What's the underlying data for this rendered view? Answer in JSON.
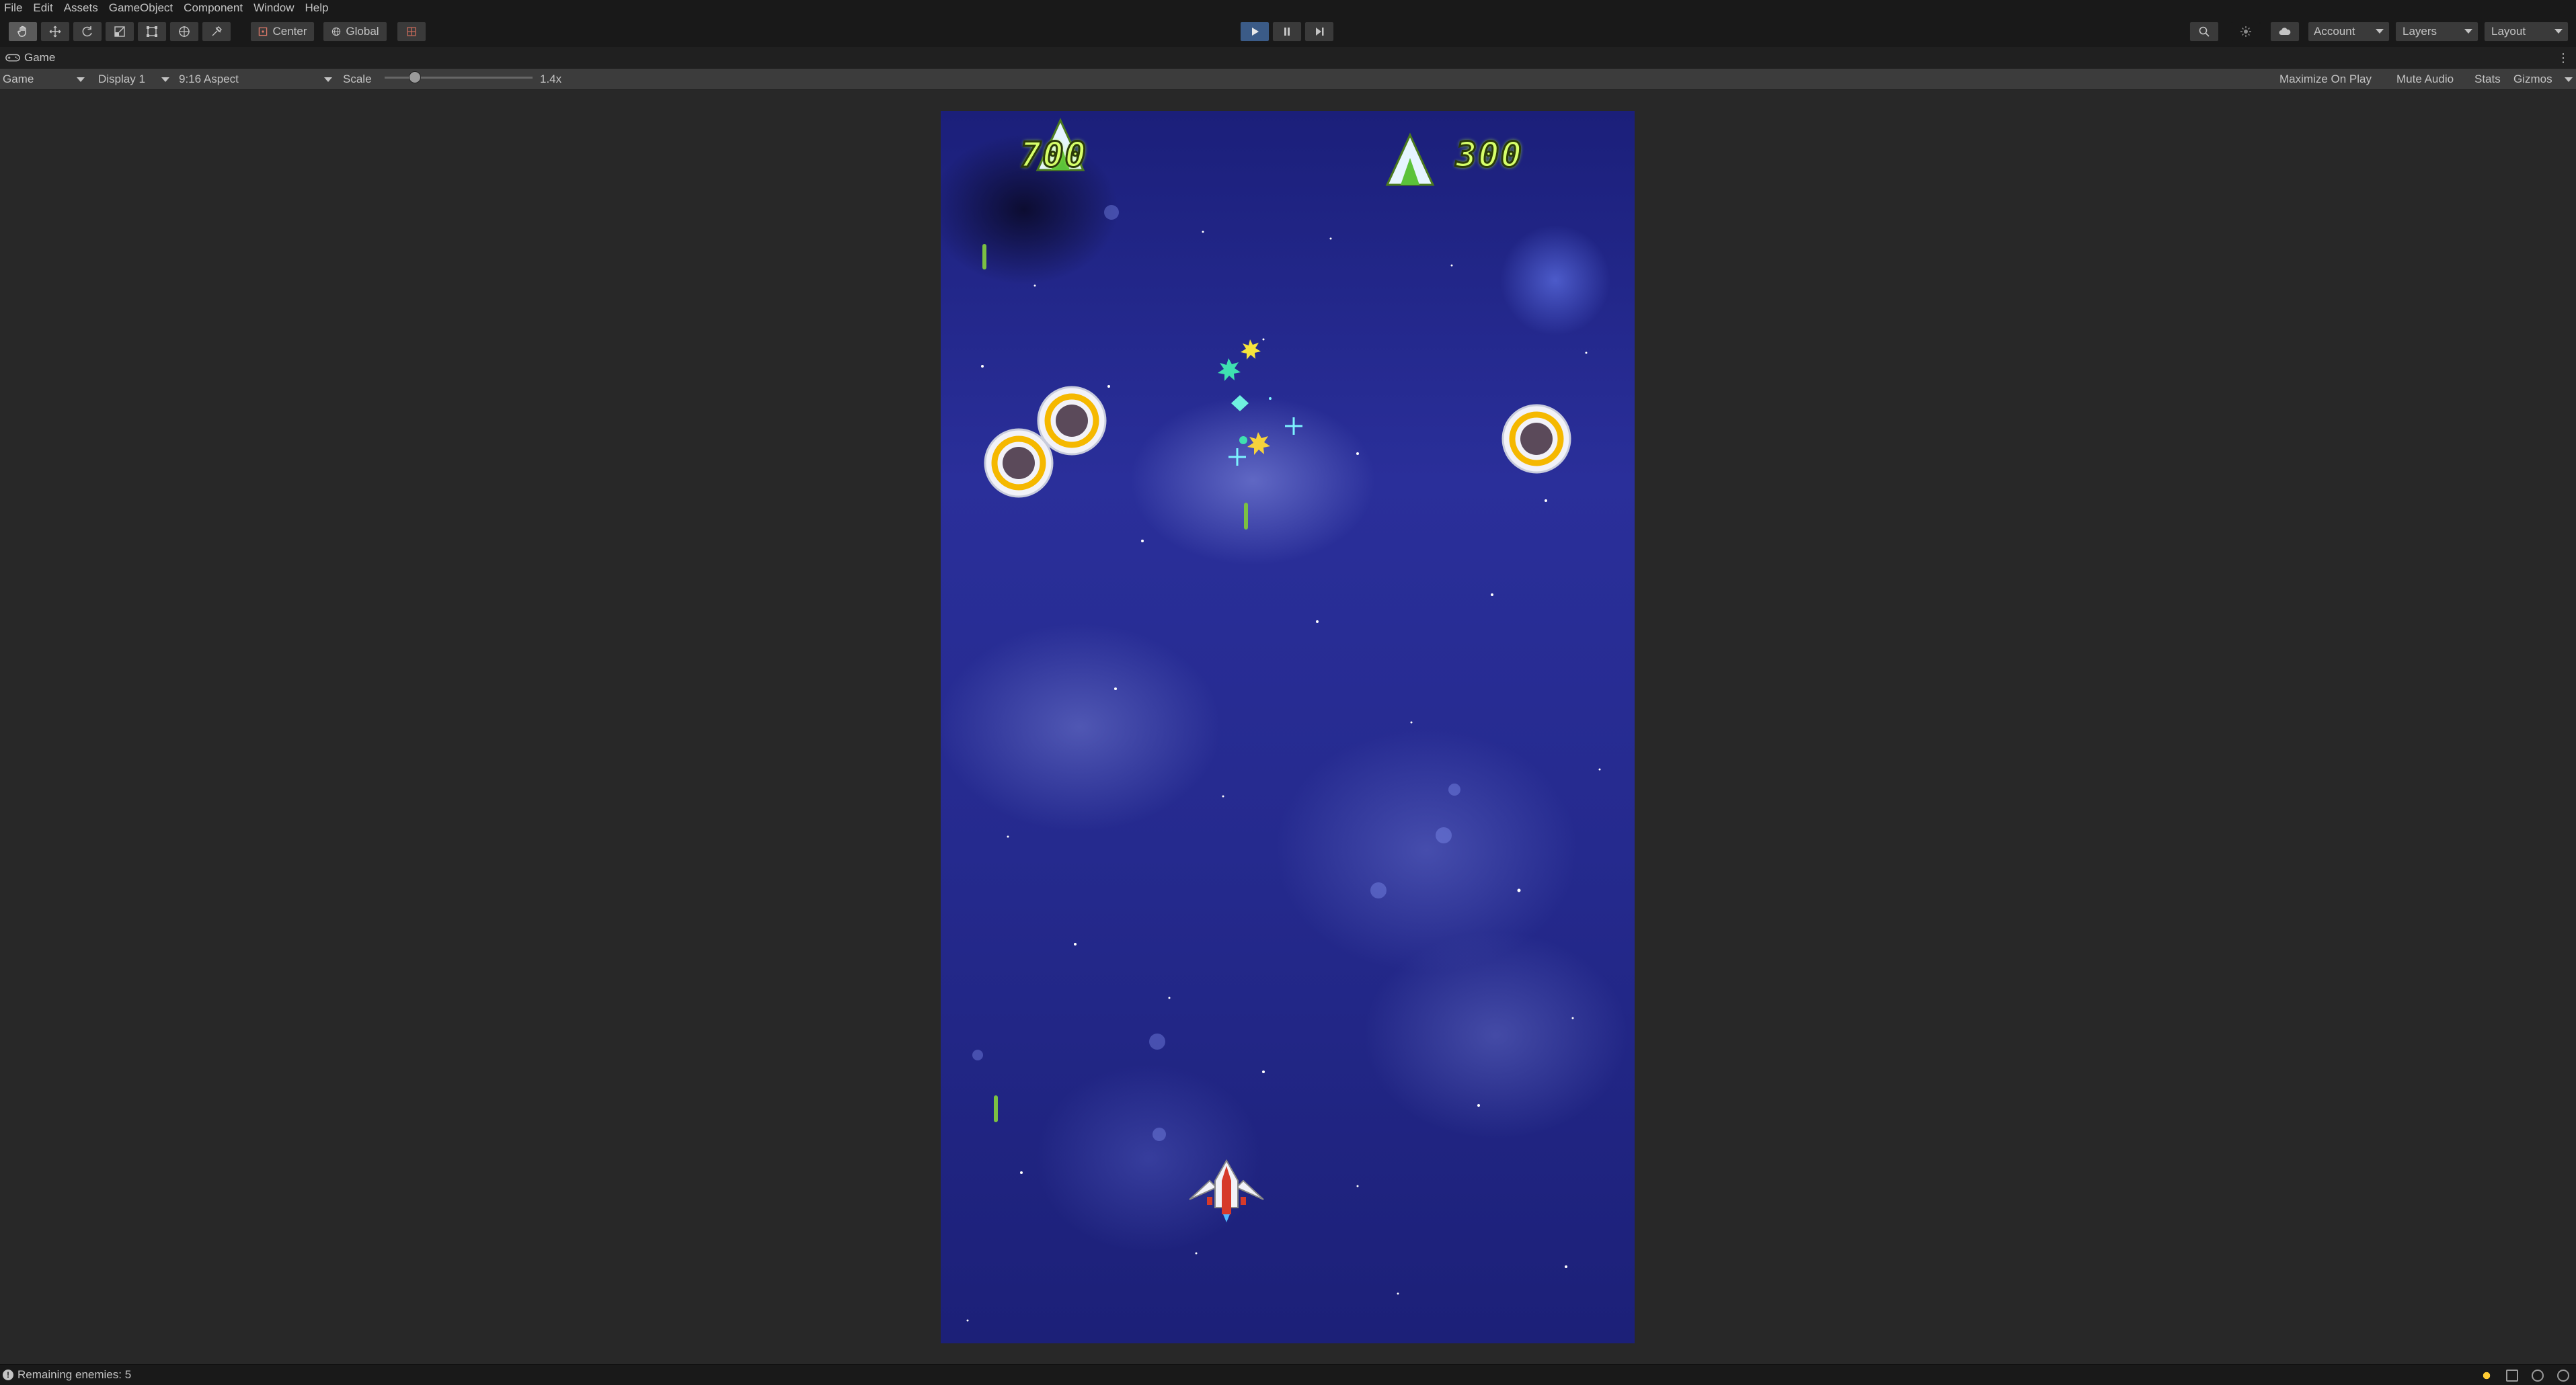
{
  "menu": [
    "File",
    "Edit",
    "Assets",
    "GameObject",
    "Component",
    "Window",
    "Help"
  ],
  "toolbar": {
    "tools": [
      "hand-tool-icon",
      "move-tool-icon",
      "rotate-tool-icon",
      "scale-tool-icon",
      "rect-tool-icon",
      "transform-tool-icon",
      "custom-tool-icon"
    ],
    "pivot_mode": "Center",
    "pivot_rotation": "Global",
    "account_label": "Account",
    "layers_label": "Layers",
    "layout_label": "Layout"
  },
  "game_tab": {
    "title": "Game"
  },
  "game_bar": {
    "view_select": "Game",
    "display_select": "Display 1",
    "aspect_select": "9:16 Aspect",
    "scale_label": "Scale",
    "scale_value": "1.4x",
    "maximize_on_play": "Maximize On Play",
    "mute_audio": "Mute Audio",
    "stats": "Stats",
    "gizmos": "Gizmos"
  },
  "hud": {
    "score_left": "700",
    "score_right": "300"
  },
  "status": {
    "message": "Remaining enemies: 5"
  },
  "colors": {
    "editor_bg": "#282828",
    "toolbar_bg": "#191919",
    "play_button": "#3b5b87",
    "score_text": "#d6ff6a",
    "laser": "#7bc043",
    "enemy_ring": "#f5b800"
  }
}
